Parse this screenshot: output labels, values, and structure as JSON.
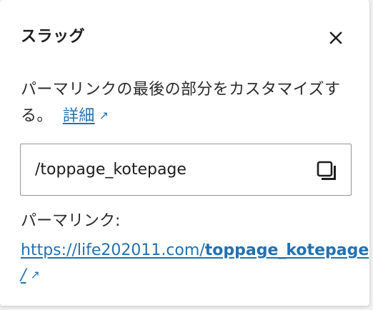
{
  "panel": {
    "title": "スラッグ",
    "close_icon": "close-icon"
  },
  "description": {
    "text": "パーマリンクの最後の部分をカスタマイズする。",
    "learn_more_label": "詳細",
    "external_icon": "external-link-icon"
  },
  "slug_field": {
    "value": "/toppage_kotepage",
    "copy_icon": "copy-icon"
  },
  "permalink": {
    "label": "パーマリンク:",
    "url_base": "https://life202011.com/",
    "url_slug": "toppage_kotepage",
    "url_trailing": "/",
    "external_icon": "external-link-icon"
  },
  "colors": {
    "link": "#2271b1",
    "text": "#1e1e1e",
    "border": "#949494",
    "background": "#ffffff"
  }
}
